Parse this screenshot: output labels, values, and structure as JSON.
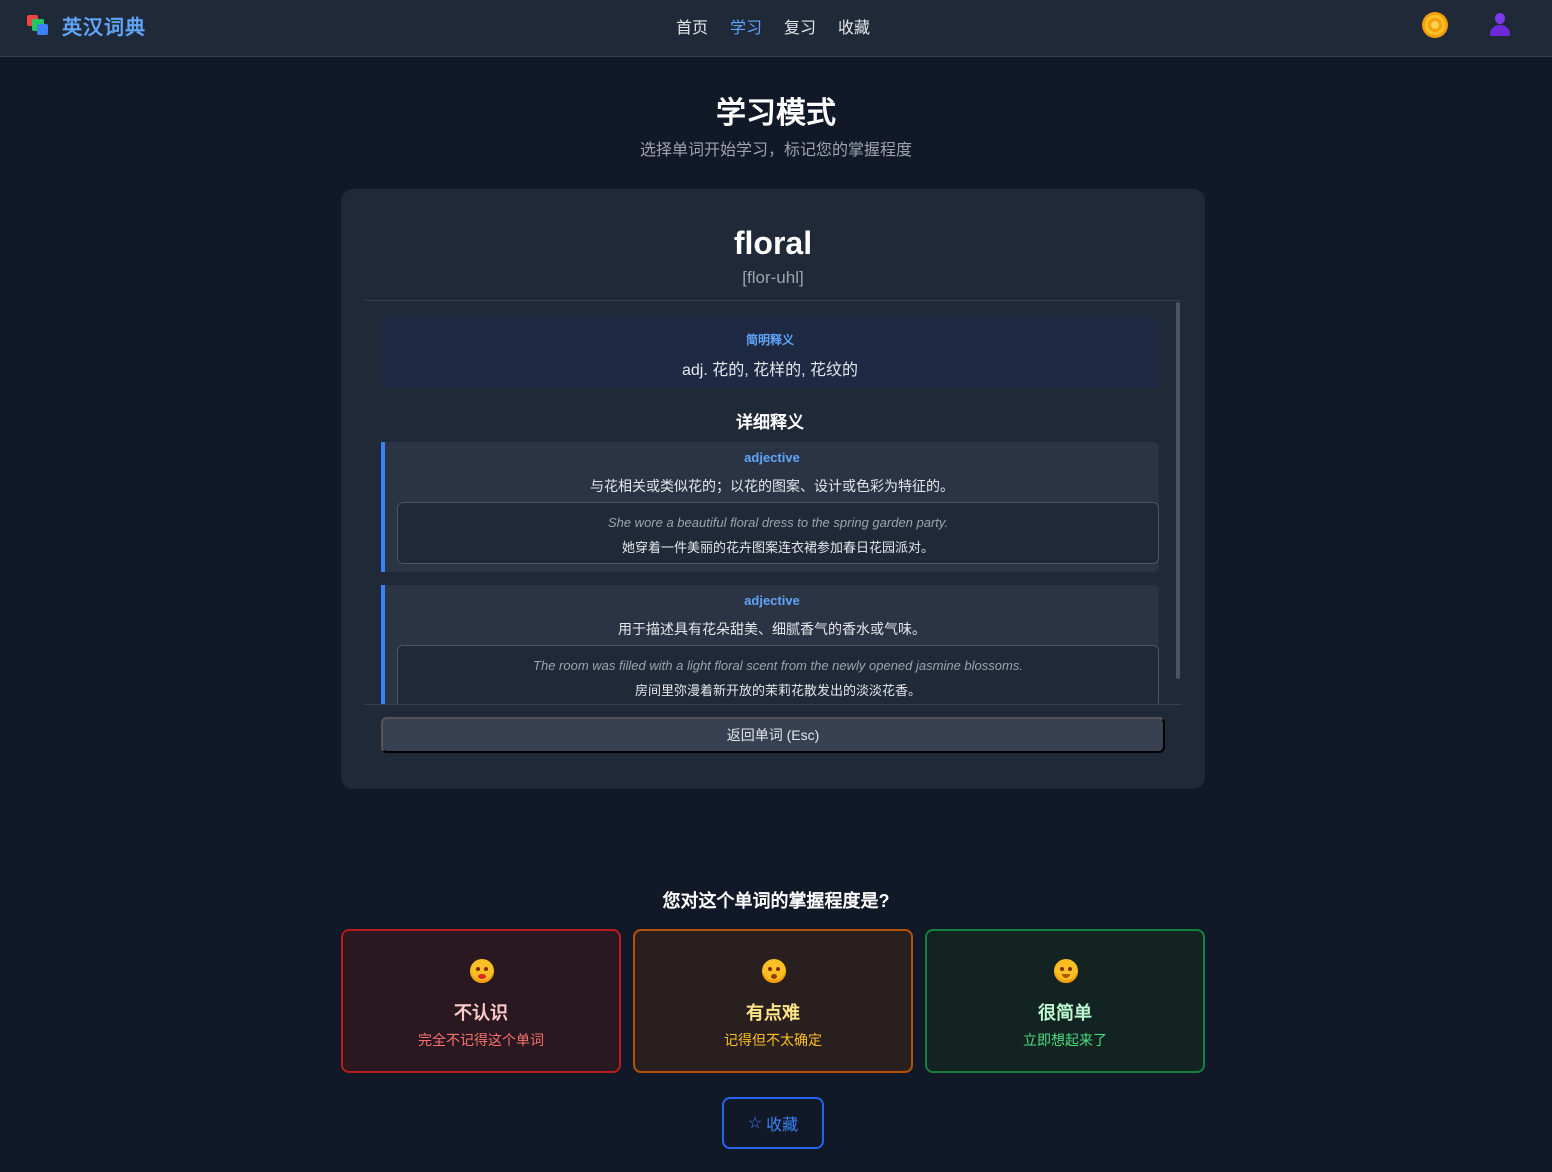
{
  "app": {
    "title": "英汉词典"
  },
  "nav": {
    "items": [
      {
        "label": "首页",
        "active": false
      },
      {
        "label": "学习",
        "active": true
      },
      {
        "label": "复习",
        "active": false
      },
      {
        "label": "收藏",
        "active": false
      }
    ],
    "icons": [
      "theme-toggle-icon",
      "user-avatar-icon"
    ]
  },
  "page": {
    "title": "学习模式",
    "subtitle": "选择单词开始学习，标记您的掌握程度"
  },
  "word": {
    "term": "floral",
    "phonetic": "[flor-uhl]",
    "brief_label": "简明释义",
    "brief": "adj. 花的, 花样的, 花纹的",
    "detail_title": "详细释义",
    "senses": [
      {
        "pos": "adjective",
        "definition": "与花相关或类似花的；以花的图案、设计或色彩为特征的。",
        "example_en": "She wore a beautiful floral dress to the spring garden party.",
        "example_zh": "她穿着一件美丽的花卉图案连衣裙参加春日花园派对。"
      },
      {
        "pos": "adjective",
        "definition": "用于描述具有花朵甜美、细腻香气的香水或气味。",
        "example_en": "The room was filled with a light floral scent from the newly opened jasmine blossoms.",
        "example_zh": "房间里弥漫着新开放的茉莉花散发出的淡淡花香。"
      }
    ],
    "back_button": "返回单词 (Esc)"
  },
  "mastery": {
    "question": "您对这个单词的掌握程度是?",
    "options": [
      {
        "title": "不认识",
        "desc": "完全不记得这个单词",
        "icon": "dizzy-face-icon",
        "color": "#b91c1c"
      },
      {
        "title": "有点难",
        "desc": "记得但不太确定",
        "icon": "flushed-face-icon",
        "color": "#b45309"
      },
      {
        "title": "很简单",
        "desc": "立即想起来了",
        "icon": "smiling-face-icon",
        "color": "#15803d"
      }
    ]
  },
  "favorite": {
    "icon": "☆",
    "label": "收藏"
  },
  "colors": {
    "accent": "#60a5fa",
    "background": "#111827",
    "card": "#1f2937"
  }
}
